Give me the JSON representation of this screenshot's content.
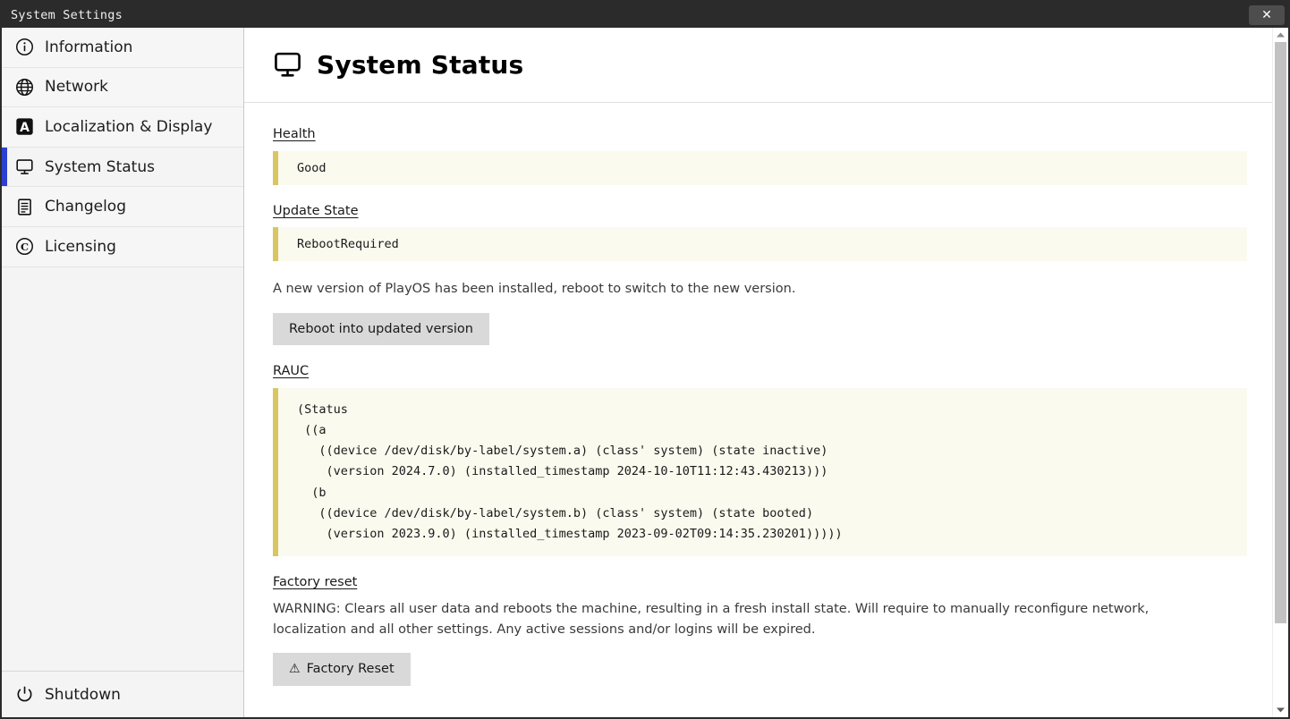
{
  "window": {
    "title": "System Settings",
    "close_label": "✕",
    "close_icon": "close-icon"
  },
  "sidebar": {
    "items": [
      {
        "label": "Information",
        "icon": "info-circle-icon",
        "active": false
      },
      {
        "label": "Network",
        "icon": "globe-icon",
        "active": false
      },
      {
        "label": "Localization & Display",
        "icon": "letter-a-icon",
        "active": false
      },
      {
        "label": "System Status",
        "icon": "monitor-icon",
        "active": true
      },
      {
        "label": "Changelog",
        "icon": "document-icon",
        "active": false
      },
      {
        "label": "Licensing",
        "icon": "copyright-icon",
        "active": false
      }
    ],
    "footer": {
      "label": "Shutdown",
      "icon": "power-icon"
    },
    "active_accent": "#2b41cf"
  },
  "page": {
    "title": "System Status",
    "title_icon": "monitor-icon"
  },
  "sections": {
    "health": {
      "heading": "Health",
      "value": "Good"
    },
    "update_state": {
      "heading": "Update State",
      "value": "RebootRequired",
      "description": "A new version of PlayOS has been installed, reboot to switch to the new version.",
      "button_label": "Reboot into updated version"
    },
    "rauc": {
      "heading": "RAUC",
      "value": "(Status\n ((a\n   ((device /dev/disk/by-label/system.a) (class' system) (state inactive)\n    (version 2024.7.0) (installed_timestamp 2024-10-10T11:12:43.430213)))\n  (b\n   ((device /dev/disk/by-label/system.b) (class' system) (state booted)\n    (version 2023.9.0) (installed_timestamp 2023-09-02T09:14:35.230201)))))"
    },
    "factory_reset": {
      "heading": "Factory reset",
      "warning": "WARNING: Clears all user data and reboots the machine, resulting in a fresh install state. Will require to manually reconfigure network, localization and all other settings. Any active sessions and/or logins will be expired.",
      "button_glyph": "⚠",
      "button_label": "Factory Reset"
    }
  },
  "scrollbar": {
    "up_icon": "chevron-up-icon",
    "down_icon": "chevron-down-icon"
  },
  "colors": {
    "accent": "#2b41cf",
    "code_border": "#d9c661",
    "code_background": "#fbfaef",
    "titlebar": "#2b2b2b",
    "button": "#d9d9d9"
  }
}
